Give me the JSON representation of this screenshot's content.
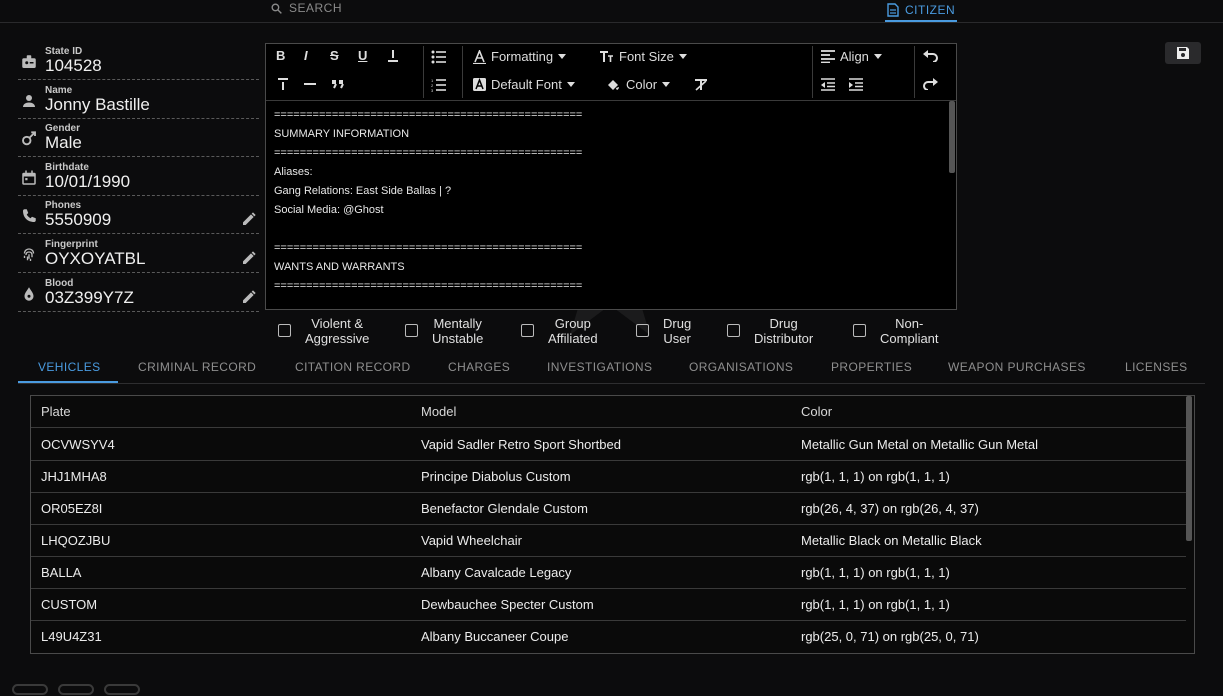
{
  "topbar": {
    "search_label": "SEARCH",
    "citizen_tab": "CITIZEN",
    "accent": "#4a9be0"
  },
  "profile": [
    {
      "label": "State ID",
      "value": "104528",
      "icon": "id-badge-icon",
      "editable": false
    },
    {
      "label": "Name",
      "value": "Jonny Bastille",
      "icon": "person-icon",
      "editable": false
    },
    {
      "label": "Gender",
      "value": "Male",
      "icon": "gender-icon",
      "editable": false
    },
    {
      "label": "Birthdate",
      "value": "10/01/1990",
      "icon": "calendar-icon",
      "editable": false
    },
    {
      "label": "Phones",
      "value": "5550909",
      "icon": "phone-icon",
      "editable": true
    },
    {
      "label": "Fingerprint",
      "value": "OYXOYATBL",
      "icon": "fingerprint-icon",
      "editable": true
    },
    {
      "label": "Blood",
      "value": "03Z399Y7Z",
      "icon": "blood-drop-icon",
      "editable": true
    }
  ],
  "editor": {
    "toolbar": {
      "formatting": "Formatting",
      "font_size": "Font Size",
      "default_font": "Default Font",
      "color": "Color",
      "align": "Align"
    },
    "lines": [
      "================================================",
      "SUMMARY INFORMATION",
      "================================================",
      "Aliases:",
      "Gang Relations: East Side Ballas | ?",
      "Social Media: @Ghost",
      "",
      "================================================",
      "WANTS AND WARRANTS",
      "================================================"
    ]
  },
  "flags": [
    {
      "line1": "Violent &",
      "line2": "Aggressive"
    },
    {
      "line1": "Mentally",
      "line2": "Unstable"
    },
    {
      "line1": "Group",
      "line2": "Affiliated"
    },
    {
      "line1": "Drug",
      "line2": "User"
    },
    {
      "line1": "Drug",
      "line2": "Distributor"
    },
    {
      "line1": "Non-",
      "line2": "Compliant"
    }
  ],
  "tabs": [
    "VEHICLES",
    "CRIMINAL RECORD",
    "CITATION RECORD",
    "CHARGES",
    "INVESTIGATIONS",
    "ORGANISATIONS",
    "PROPERTIES",
    "WEAPON PURCHASES",
    "LICENSES"
  ],
  "table": {
    "headers": [
      "Plate",
      "Model",
      "Color"
    ],
    "rows": [
      [
        "OCVWSYV4",
        "Vapid Sadler Retro Sport Shortbed",
        "Metallic Gun Metal on Metallic Gun Metal"
      ],
      [
        "JHJ1MHA8",
        "Principe Diabolus Custom",
        "rgb(1, 1, 1) on rgb(1, 1, 1)"
      ],
      [
        "OR05EZ8I",
        "Benefactor Glendale Custom",
        "rgb(26, 4, 37) on rgb(26, 4, 37)"
      ],
      [
        "LHQOZJBU",
        "Vapid Wheelchair",
        "Metallic Black on Metallic Black"
      ],
      [
        "BALLA",
        "Albany Cavalcade Legacy",
        "rgb(1, 1, 1) on rgb(1, 1, 1)"
      ],
      [
        "CUSTOM",
        "Dewbauchee Specter Custom",
        "rgb(1, 1, 1) on rgb(1, 1, 1)"
      ],
      [
        "L49U4Z31",
        "Albany Buccaneer Coupe",
        "rgb(25, 0, 71) on rgb(25, 0, 71)"
      ]
    ]
  }
}
